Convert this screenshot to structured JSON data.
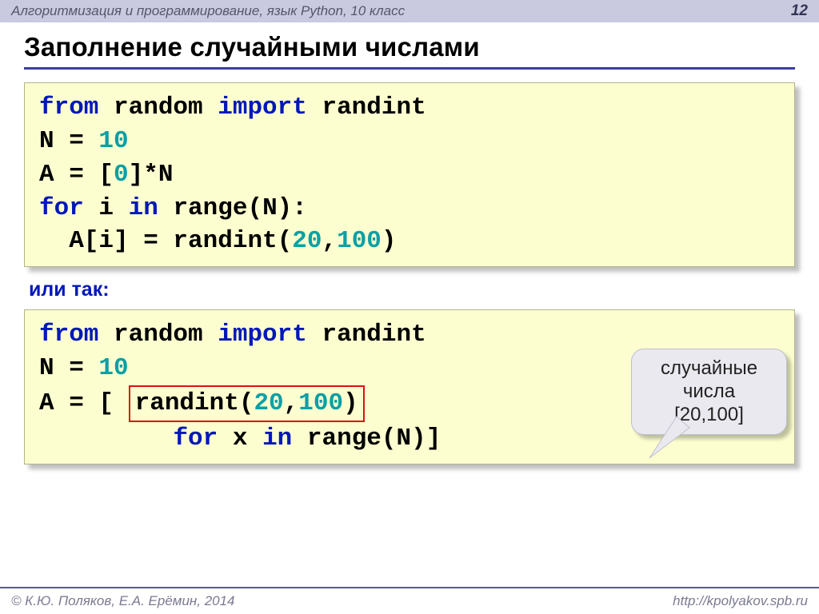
{
  "header": {
    "course": "Алгоритмизация и программирование, язык Python, 10 класс",
    "page": "12"
  },
  "title": "Заполнение случайными числами",
  "code1": {
    "l1_kw1": "from",
    "l1_p1": " random ",
    "l1_kw2": "import",
    "l1_p2": " randint",
    "l2_p1": "N = ",
    "l2_n1": "10",
    "l3_p1": "A = [",
    "l3_n1": "0",
    "l3_p2": "]*N",
    "l4_kw1": "for",
    "l4_p1": " i ",
    "l4_kw2": "in",
    "l4_p2": " range(N):",
    "l5_p1": "  A[i] = randint(",
    "l5_n1": "20",
    "l5_p2": ",",
    "l5_n2": "100",
    "l5_p3": ")"
  },
  "or_label": "или так:",
  "code2": {
    "l1_kw1": "from",
    "l1_p1": " random ",
    "l1_kw2": "import",
    "l1_p2": " randint",
    "l2_p1": "N = ",
    "l2_n1": "10",
    "l3_p1": "A = [ ",
    "l3_hp1": "randint(",
    "l3_hn1": "20",
    "l3_hp2": ",",
    "l3_hn2": "100",
    "l3_hp3": ")",
    "l4_pad": "         ",
    "l4_kw1": "for",
    "l4_p1": " x ",
    "l4_kw2": "in",
    "l4_p2": " range(N)]"
  },
  "callout": {
    "line1": "случайные",
    "line2": "числа",
    "line3": "[20,100]"
  },
  "footer": {
    "left": "© К.Ю. Поляков, Е.А. Ерёмин, 2014",
    "right": "http://kpolyakov.spb.ru"
  }
}
